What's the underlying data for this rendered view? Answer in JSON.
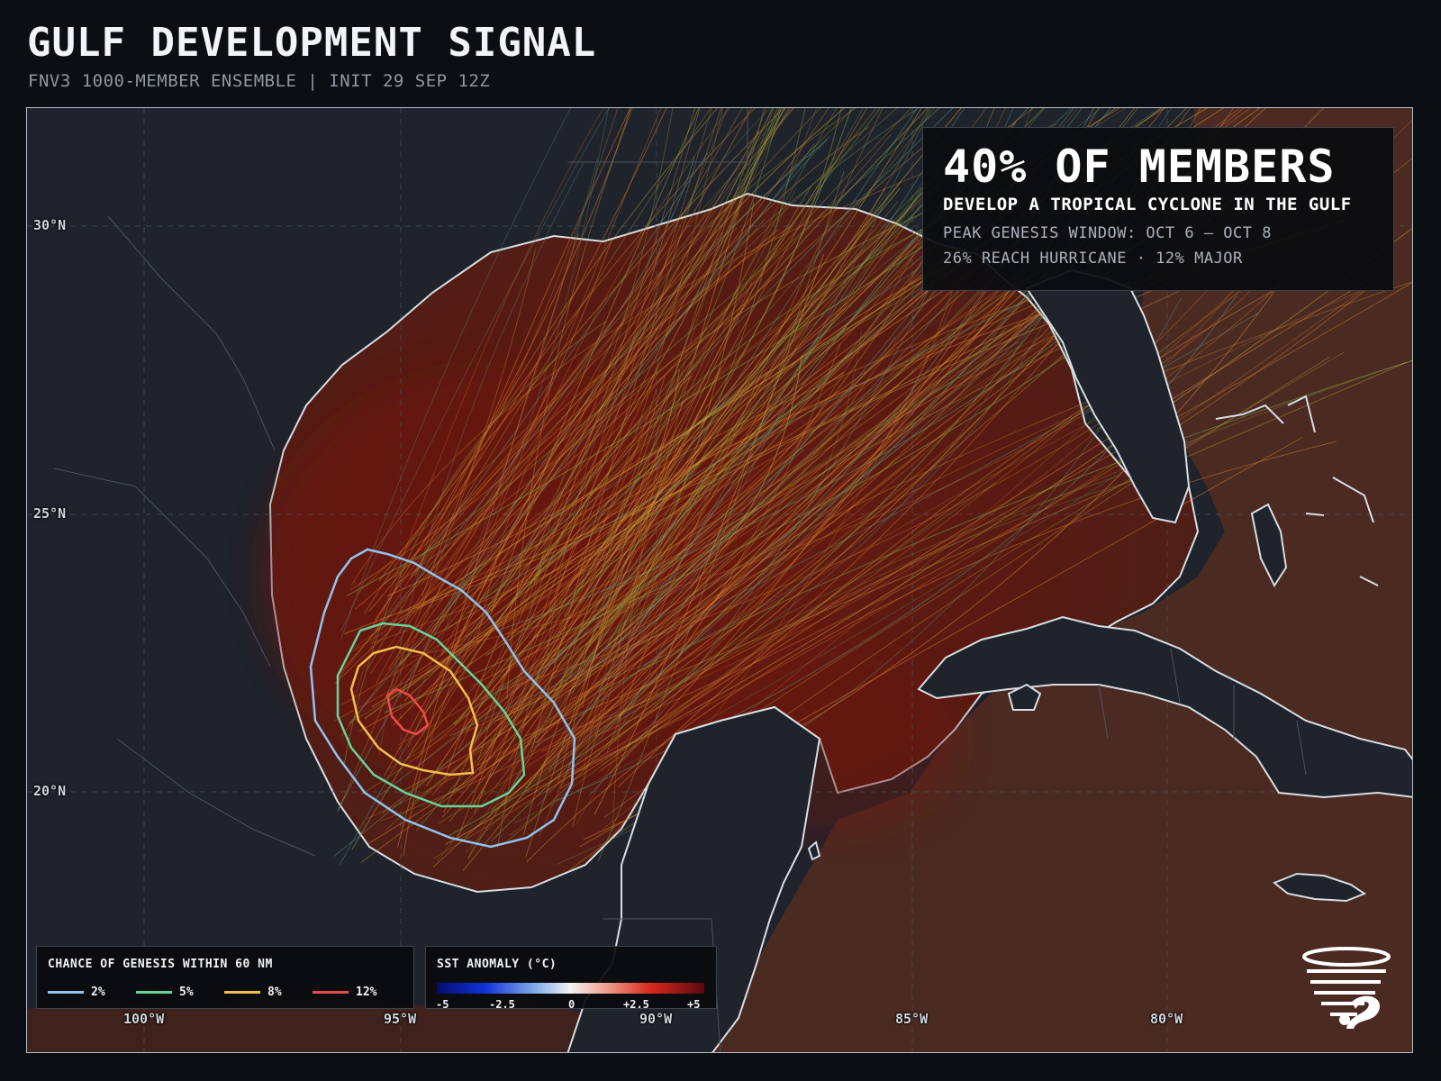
{
  "header": {
    "title": "GULF DEVELOPMENT SIGNAL",
    "subtitle": "FNV3 1000-MEMBER ENSEMBLE | INIT 29 SEP 12Z"
  },
  "map": {
    "lat_labels": [
      "30°N",
      "25°N",
      "20°N"
    ],
    "lon_labels": [
      "100°W",
      "95°W",
      "90°W",
      "85°W",
      "80°W"
    ]
  },
  "callout": {
    "headline": "40% OF MEMBERS",
    "subhead": "DEVELOP A TROPICAL CYCLONE IN THE GULF",
    "line1": "PEAK GENESIS WINDOW: OCT 6 – OCT 8",
    "line2": "26% REACH HURRICANE · 12% MAJOR"
  },
  "genesis_legend": {
    "title": "CHANCE OF GENESIS WITHIN 60 NM",
    "items": [
      {
        "label": "2%",
        "color": "#8ec4ee"
      },
      {
        "label": "5%",
        "color": "#6ad39a"
      },
      {
        "label": "8%",
        "color": "#f4c04c"
      },
      {
        "label": "12%",
        "color": "#ee4a4a"
      }
    ]
  },
  "sst_legend": {
    "title": "SST ANOMALY (°C)",
    "ticks": [
      "-5",
      "-2.5",
      "0",
      "+2.5",
      "+5"
    ]
  },
  "colors": {
    "background": "#0b0e12",
    "land": "#1f232b",
    "warm_water": "#5e1a10",
    "coastline": "#d8dde4"
  },
  "logo": {
    "icon": "tornado-logo-icon"
  }
}
